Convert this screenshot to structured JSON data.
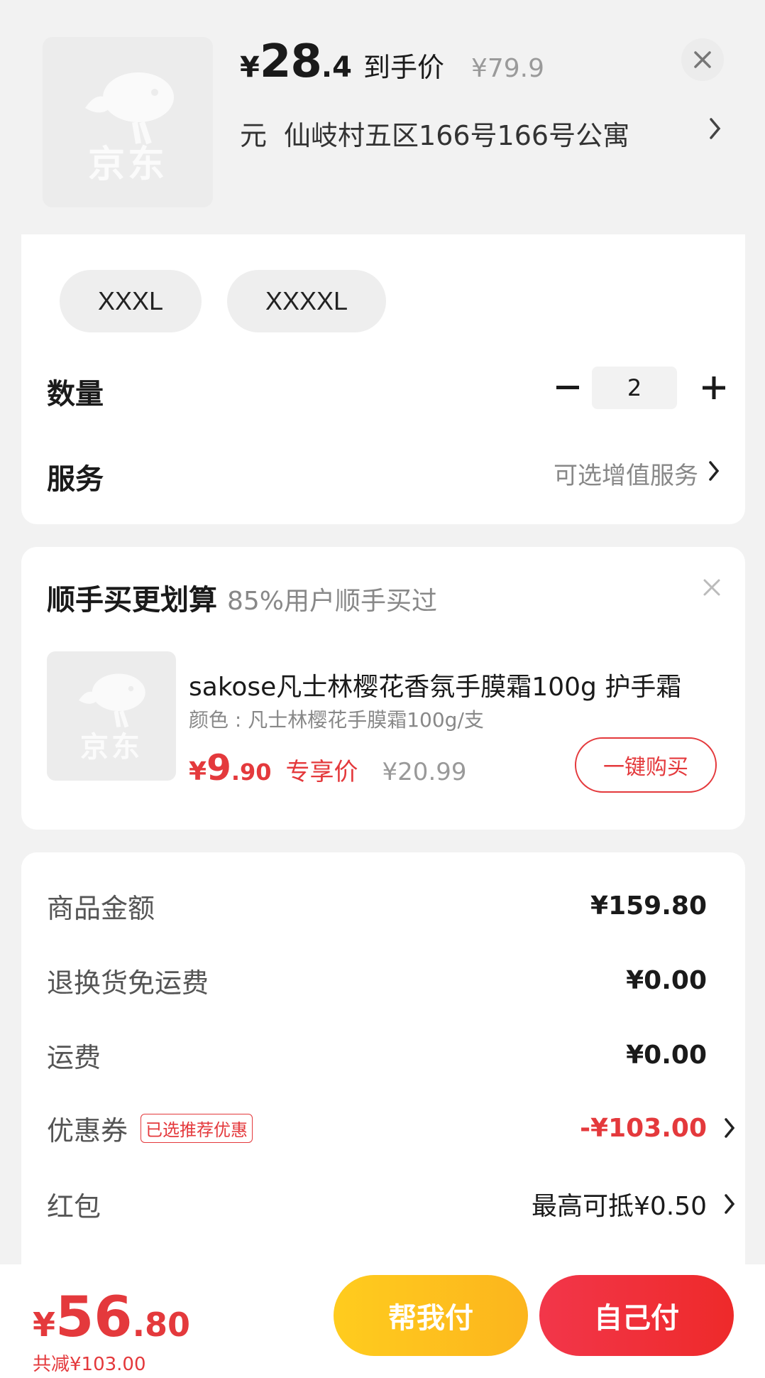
{
  "header": {
    "price_yen": "¥",
    "price_int": "28",
    "price_dec": ".4",
    "price_tag": "到手价",
    "price_orig": "¥79.9",
    "address_prefix": "元",
    "address": "仙岐村五区166号166号公寓",
    "logo_text": "京东"
  },
  "spec": {
    "sizes": [
      "XXXL",
      "XXXXL"
    ]
  },
  "quantity": {
    "label": "数量",
    "value": "2"
  },
  "service": {
    "label": "服务",
    "value": "可选增值服务"
  },
  "recommend": {
    "title": "顺手买更划算",
    "subtitle": "85%用户顺手买过",
    "product_title": "sakose凡士林樱花香氛手膜霜100g 护手霜",
    "product_spec": "颜色 : 凡士林樱花手膜霜100g/支",
    "price_yen": "¥",
    "price_int": "9",
    "price_dec": ".90",
    "price_tag": "专享价",
    "price_orig": "¥20.99",
    "buy_label": "一键购买",
    "logo_text": "京东"
  },
  "summary": {
    "goods_label": "商品金额",
    "goods_value": "¥159.80",
    "return_label": "退换货免运费",
    "return_value": "¥0.00",
    "ship_label": "运费",
    "ship_value": "¥0.00",
    "coupon_label": "优惠券",
    "coupon_badge": "已选推荐优惠",
    "coupon_value": "-¥103.00",
    "redpack_label": "红包",
    "redpack_value": "最高可抵¥0.50"
  },
  "footer": {
    "total_yen": "¥",
    "total_int": "56",
    "total_dec": ".80",
    "saved": "共减¥103.00",
    "help_pay": "帮我付",
    "self_pay": "自己付"
  },
  "colors": {
    "accent": "#e4393c",
    "yellow": "#fcb51d"
  }
}
